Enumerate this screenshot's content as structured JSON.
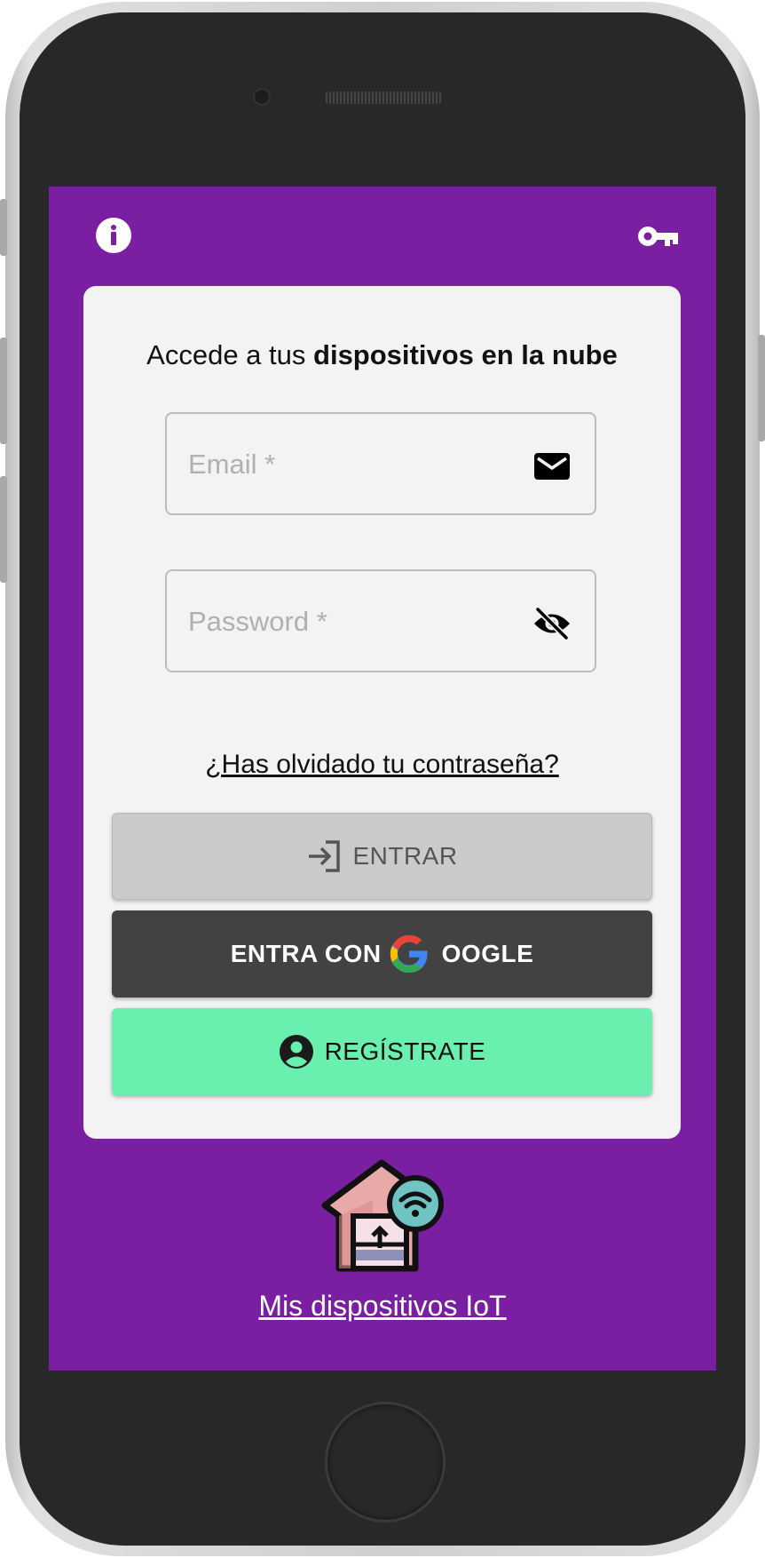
{
  "screen": {
    "background_color": "#7b1fa2",
    "top_left_icon": "info-icon",
    "top_right_icon": "key-icon"
  },
  "login_card": {
    "heading_normal": "Accede a tus ",
    "heading_bold": "dispositivos en la nube",
    "email": {
      "placeholder": "Email *",
      "value": "",
      "icon": "mail-icon"
    },
    "password": {
      "placeholder": "Password *",
      "value": "",
      "icon": "eye-off-icon"
    },
    "forgot_link": "¿Has olvidado tu contraseña?",
    "login_button": {
      "label": "ENTRAR",
      "icon": "login-icon",
      "color": "#cacaca"
    },
    "google_button": {
      "label_before": "ENTRA CON ",
      "label_after": "OOGLE",
      "icon": "google-g-icon",
      "color": "#424242"
    },
    "register_button": {
      "label": "REGÍSTRATE",
      "icon": "account-circle-icon",
      "color": "#69f0ae"
    }
  },
  "footer": {
    "logo_icon": "smart-home-wifi-icon",
    "link_label": "Mis dispositivos IoT"
  }
}
